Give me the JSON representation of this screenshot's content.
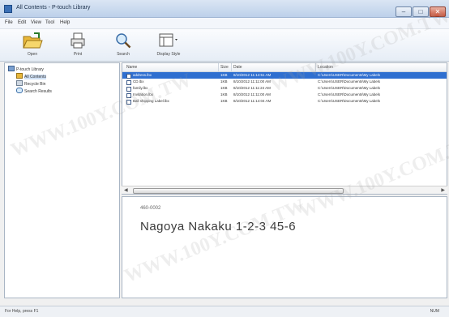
{
  "window": {
    "title": "All Contents - P-touch Library",
    "min_glyph": "–",
    "max_glyph": "□",
    "close_glyph": "✕"
  },
  "menu": [
    "File",
    "Edit",
    "View",
    "Tool",
    "Help"
  ],
  "toolbar": {
    "open": "Open",
    "print": "Print",
    "search": "Search",
    "display_style": "Display Style"
  },
  "tree": {
    "root": "P-touch Library",
    "items": [
      "All Contents",
      "Recycle Bin",
      "Search Results"
    ]
  },
  "list": {
    "columns": [
      "Name",
      "Size",
      "Date",
      "Location"
    ],
    "rows": [
      {
        "name": "address.lbx",
        "size": "1KB",
        "date": "8/10/2012 11:14:51 AM",
        "location": "C:\\Users\\USER\\Documents\\My Labels"
      },
      {
        "name": "CD.lbx",
        "size": "1KB",
        "date": "8/10/2012 11:11:00 AM",
        "location": "C:\\Users\\USER\\Documents\\My Labels"
      },
      {
        "name": "family.lbx",
        "size": "1KB",
        "date": "8/10/2012 11:11:24 AM",
        "location": "C:\\Users\\USER\\Documents\\My Labels"
      },
      {
        "name": "Invitation.lbx",
        "size": "1KB",
        "date": "8/10/2012 11:11:00 AM",
        "location": "C:\\Users\\USER\\Documents\\My Labels"
      },
      {
        "name": "Ball shipping Label.lbx",
        "size": "1KB",
        "date": "8/10/2012 11:14:04 AM",
        "location": "C:\\Users\\USER\\Documents\\My Labels"
      }
    ]
  },
  "preview": {
    "line1": "460-0002",
    "line2": "Nagoya Nakaku 1-2-3 45-6"
  },
  "status": {
    "text": "For Help, press F1",
    "right": "NUM"
  },
  "watermark": "WWW.100Y.COM.TW",
  "colors": {
    "selection": "#2f6fd0",
    "titlebar": "#bcd0ea"
  }
}
